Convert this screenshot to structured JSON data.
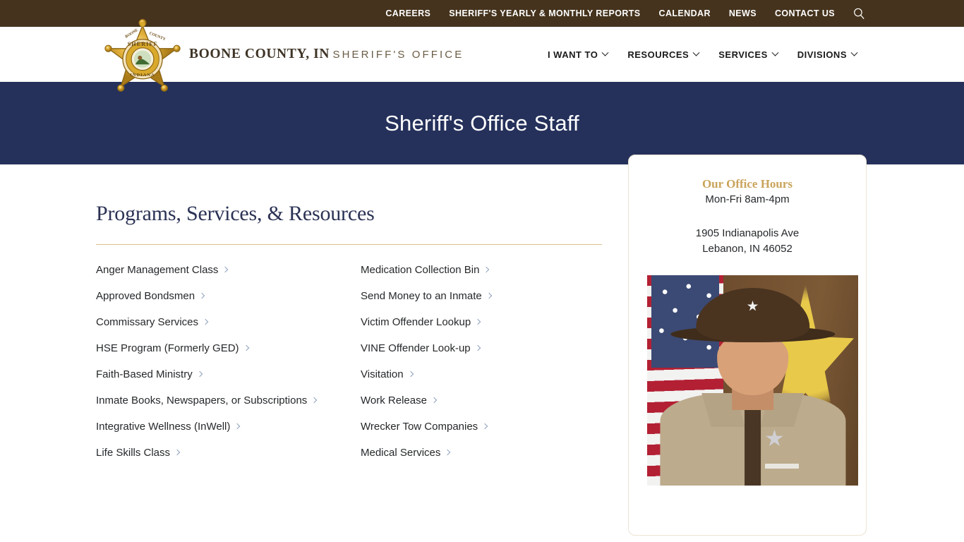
{
  "topbar": {
    "links": [
      {
        "label": "CAREERS",
        "name": "careers"
      },
      {
        "label": "SHERIFF'S YEARLY & MONTHLY REPORTS",
        "name": "reports"
      },
      {
        "label": "CALENDAR",
        "name": "calendar"
      },
      {
        "label": "NEWS",
        "name": "news"
      },
      {
        "label": "CONTACT US",
        "name": "contact-us"
      }
    ],
    "search_icon": "search-icon",
    "background_color": "#45331d"
  },
  "header": {
    "logo_icon": "sheriff-star-badge-icon",
    "brand_line1": "BOONE COUNTY, IN",
    "brand_line2": "SHERIFF'S OFFICE",
    "nav": [
      {
        "label": "I WANT TO",
        "name": "i-want-to"
      },
      {
        "label": "RESOURCES",
        "name": "resources"
      },
      {
        "label": "SERVICES",
        "name": "services"
      },
      {
        "label": "DIVISIONS",
        "name": "divisions"
      }
    ]
  },
  "banner": {
    "title": "Sheriff's Office Staff",
    "background_color": "#25315b"
  },
  "main": {
    "heading": "Programs, Services, & Resources",
    "divider_color": "#d9be8b",
    "column_left": [
      "Anger Management Class",
      "Approved Bondsmen",
      "Commissary Services",
      "HSE Program (Formerly GED)",
      "Faith-Based Ministry",
      "Inmate Books, Newspapers, or Subscriptions",
      "Integrative Wellness (InWell)",
      "Life Skills Class"
    ],
    "column_right": [
      "Medication Collection Bin",
      "Send Money to an Inmate",
      "Victim Offender Lookup",
      "VINE Offender Look-up",
      "Visitation",
      "Work Release",
      "Wrecker Tow Companies",
      "Medical Services"
    ]
  },
  "sidebar": {
    "card_title": "Our Office Hours",
    "card_title_color": "#c9a35a",
    "hours": "Mon-Fri  8am-4pm",
    "address_line1": "1905 Indianapolis Ave",
    "address_line2": "Lebanon, IN 46052",
    "photo_alt": "sheriff-portrait-photo"
  }
}
